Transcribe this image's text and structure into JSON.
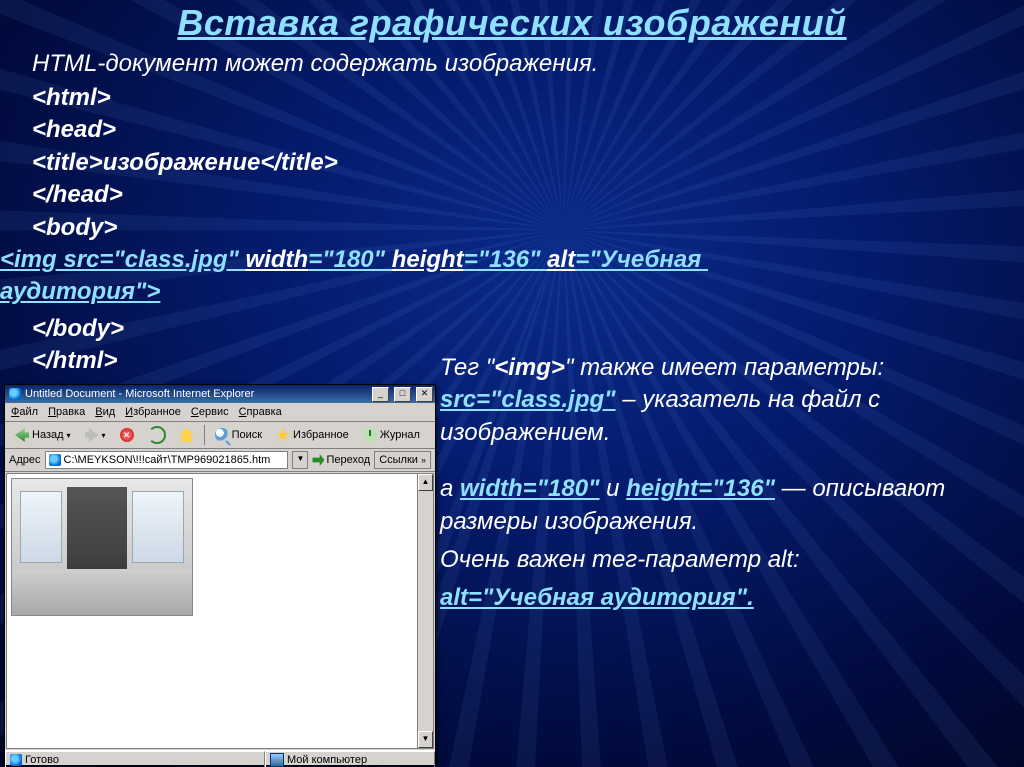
{
  "title": "Вставка графических изображений",
  "intro": "HTML-документ может содержать изображения.",
  "code": {
    "l1": "<html>",
    "l2": "<head>",
    "l3": "<title>изображение</title>",
    "l4": "</head>",
    "l5": "<body>",
    "img_open": "<img src=\"class.jpg\" ",
    "img_width_kw": "width",
    "img_width_rest": "=\"180\" ",
    "img_height_kw": "height",
    "img_height_rest": "=\"136\" ",
    "img_alt_kw": "alt",
    "img_alt_rest": "=\"Учебная ",
    "img_line2": "аудитория\">",
    "l6": "</body>",
    "l7": "</html>"
  },
  "desc": {
    "p1a": "Тег \"",
    "p1tag": "<img>",
    "p1b": "\" также имеет параметры: ",
    "p1src": "src=\"class.jpg\"",
    "p1c": " – указатель на файл с изображением.",
    "p2a": "а ",
    "p2w": "width=\"180\"",
    "p2b": " и ",
    "p2h": "height=\"136\"",
    "p2c": " — описывают размеры изображения.",
    "p3": "Очень важен тег-параметр alt:",
    "p3alt": "alt=\"Учебная аудитория\"."
  },
  "browser": {
    "title": "Untitled Document - Microsoft Internet Explorer",
    "menu": [
      "Файл",
      "Правка",
      "Вид",
      "Избранное",
      "Сервис",
      "Справка"
    ],
    "back": "Назад",
    "search": "Поиск",
    "fav": "Избранное",
    "history": "Журнал",
    "addr_label": "Адрес",
    "address": "C:\\MEYKSON\\!!!сайт\\TMP969021865.htm",
    "go": "Переход",
    "links": "Ссылки",
    "status_ready": "Готово",
    "status_zone": "Мой компьютер",
    "min": "_",
    "max": "□",
    "close": "✕",
    "dd": "▼",
    "up": "▲",
    "dn": "▼",
    "back_dd": "▾",
    "fwd_dd": "▾",
    "links_dd": "»"
  }
}
